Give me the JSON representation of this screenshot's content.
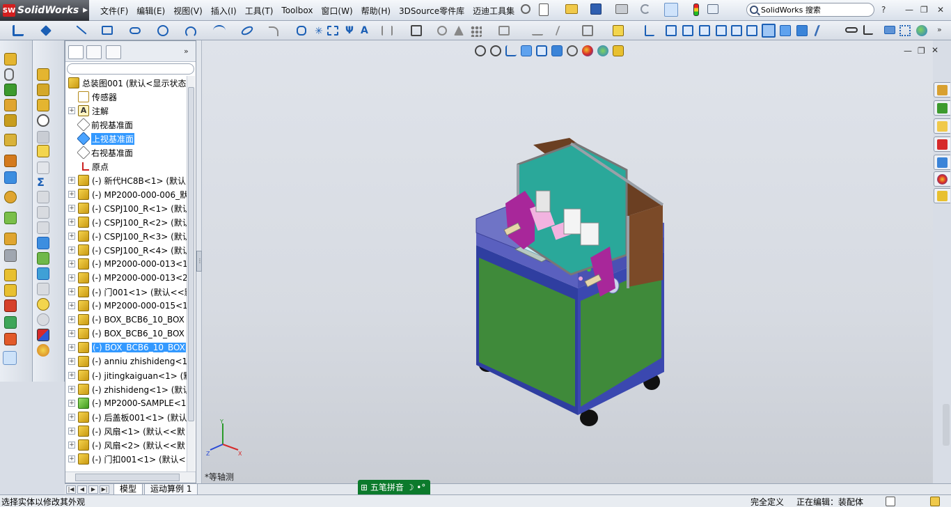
{
  "app": {
    "name": "SolidWorks",
    "logo_mark": "SW"
  },
  "menu": [
    "文件(F)",
    "编辑(E)",
    "视图(V)",
    "插入(I)",
    "工具(T)",
    "Toolbox",
    "窗口(W)",
    "帮助(H)",
    "3DSource零件库",
    "迈迪工具集"
  ],
  "search": {
    "placeholder": "SolidWorks 搜索"
  },
  "feature_tree": {
    "root": "总装图001 (默认<显示状态",
    "items": [
      {
        "label": "传感器",
        "icon": "sensor-icon",
        "expand": false
      },
      {
        "label": "注解",
        "icon": "annotation-icon",
        "expand": true
      },
      {
        "label": "前视基准面",
        "icon": "plane-icon",
        "expand": false
      },
      {
        "label": "上视基准面",
        "icon": "plane-icon",
        "expand": false,
        "selected": true
      },
      {
        "label": "右视基准面",
        "icon": "plane-icon",
        "expand": false
      },
      {
        "label": "原点",
        "icon": "origin-icon",
        "expand": false
      },
      {
        "label": "(-) 新代HC8B<1> (默认",
        "icon": "assembly-icon",
        "expand": true
      },
      {
        "label": "(-) MP2000-000-006_默",
        "icon": "assembly-icon",
        "expand": true
      },
      {
        "label": "(-) CSPJ100_R<1> (默认",
        "icon": "assembly-icon",
        "expand": true
      },
      {
        "label": "(-) CSPJ100_R<2> (默认",
        "icon": "assembly-icon",
        "expand": true
      },
      {
        "label": "(-) CSPJ100_R<3> (默认",
        "icon": "assembly-icon",
        "expand": true
      },
      {
        "label": "(-) CSPJ100_R<4> (默认",
        "icon": "assembly-icon",
        "expand": true
      },
      {
        "label": "(-) MP2000-000-013<1",
        "icon": "assembly-icon",
        "expand": true
      },
      {
        "label": "(-) MP2000-000-013<2",
        "icon": "assembly-icon",
        "expand": true
      },
      {
        "label": "(-) 门001<1> (默认<<默",
        "icon": "assembly-icon",
        "expand": true
      },
      {
        "label": "(-) MP2000-000-015<1",
        "icon": "assembly-icon",
        "expand": true
      },
      {
        "label": "(-) BOX_BCB6_10_BOX",
        "icon": "assembly-icon",
        "expand": true
      },
      {
        "label": "(-) BOX_BCB6_10_BOX",
        "icon": "assembly-icon",
        "expand": true
      },
      {
        "label": "(-) BOX_BCB6_10_BOX",
        "icon": "assembly-icon",
        "expand": true,
        "selected": true
      },
      {
        "label": "(-) anniu zhishideng<1",
        "icon": "assembly-icon",
        "expand": true
      },
      {
        "label": "(-) jitingkaiguan<1> (默",
        "icon": "assembly-icon",
        "expand": true
      },
      {
        "label": "(-) zhishideng<1> (默认",
        "icon": "assembly-icon",
        "expand": true
      },
      {
        "label": "(-) MP2000-SAMPLE<1",
        "icon": "assembly-green-icon",
        "expand": true
      },
      {
        "label": "(-) 后盖板001<1> (默认",
        "icon": "assembly-icon",
        "expand": true
      },
      {
        "label": "(-) 风扇<1> (默认<<默",
        "icon": "assembly-icon",
        "expand": true
      },
      {
        "label": "(-) 风扇<2> (默认<<默",
        "icon": "assembly-icon",
        "expand": true
      },
      {
        "label": "(-) 门扣001<1> (默认<",
        "icon": "assembly-icon",
        "expand": true
      }
    ]
  },
  "bottom_tabs": [
    "模型",
    "运动算例 1"
  ],
  "view_name": "*等轴测",
  "triad": {
    "x": "X",
    "y": "Y",
    "z": "Z"
  },
  "ime": {
    "mode": "五笔拼音",
    "char_set": "简"
  },
  "status": {
    "left": "选择实体以修改其外观",
    "definition": "完全定义",
    "editing": "正在编辑：装配体"
  },
  "colors": {
    "base_top": "#6f74c6",
    "base_front": "#2f3ea0",
    "door_green": "#3f8a3a",
    "frame_panel": "#6b3f22",
    "teal_plate": "#2aa89a",
    "roller_purple": "#a8279a"
  }
}
